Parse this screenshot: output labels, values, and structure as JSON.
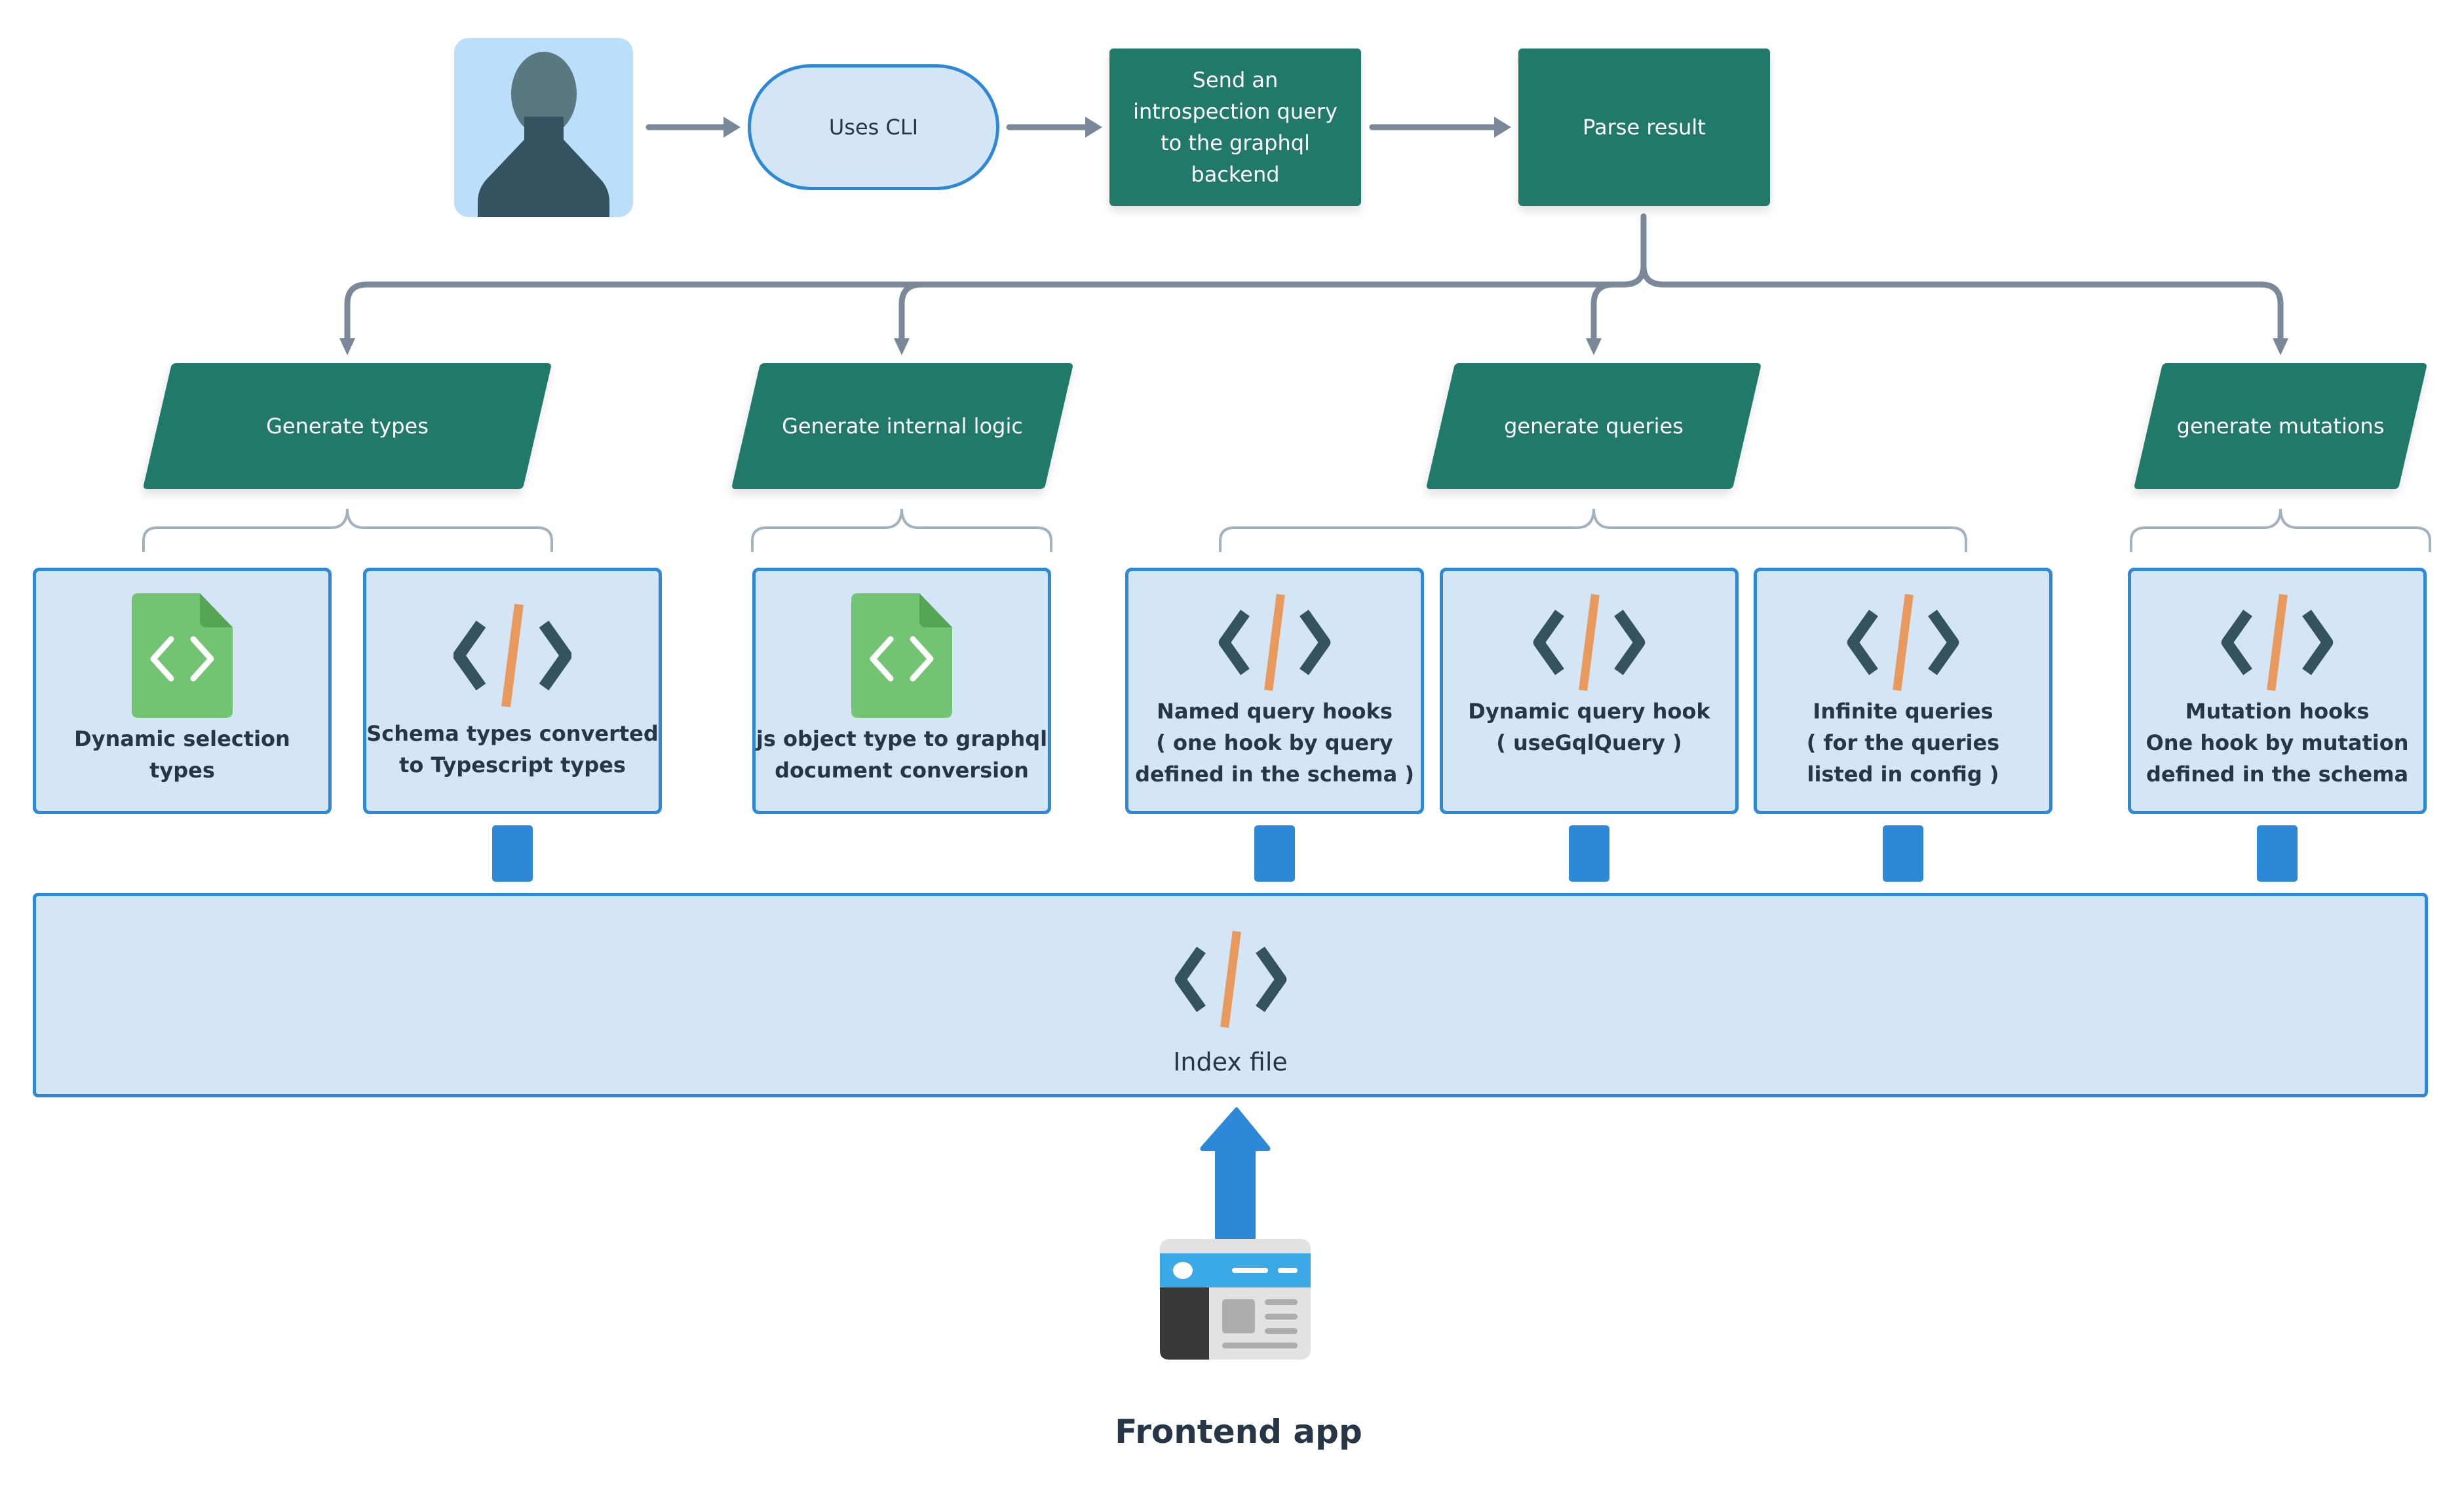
{
  "colors": {
    "green": "#21796a",
    "blue": "#2e88d8",
    "light_blue": "#d4e6f6",
    "line_gray": "#7a8899",
    "text_dark": "#263646",
    "orange": "#e8995e",
    "file_green": "#72c472"
  },
  "flow": {
    "user_icon": "person-silhouette-icon",
    "uses_cli": "Uses CLI",
    "introspection_lines": [
      "Send an",
      "introspection query",
      "to the graphql",
      "backend"
    ],
    "parse_result": "Parse result"
  },
  "generators": [
    {
      "label": "Generate types"
    },
    {
      "label": "Generate internal logic"
    },
    {
      "label": "generate queries"
    },
    {
      "label": "generate mutations"
    }
  ],
  "outputs": [
    {
      "icon": "code-file-icon",
      "label": "Dynamic selection\ntypes"
    },
    {
      "icon": "code-tag-icon",
      "label": "Schema types converted\nto Typescript types"
    },
    {
      "icon": "code-file-icon",
      "label": "js object type to graphql\ndocument conversion"
    },
    {
      "icon": "code-tag-icon",
      "label": "Named query hooks\n( one hook by query\ndefined in the schema )"
    },
    {
      "icon": "code-tag-icon",
      "label": "Dynamic query hook\n( useGqlQuery )"
    },
    {
      "icon": "code-tag-icon",
      "label": "Infinite queries\n( for the queries\nlisted in config )"
    },
    {
      "icon": "code-tag-icon",
      "label": "Mutation hooks\nOne hook by mutation\ndefined in the schema"
    }
  ],
  "index_file": {
    "label": "Index file"
  },
  "frontend": {
    "label": "Frontend app"
  }
}
